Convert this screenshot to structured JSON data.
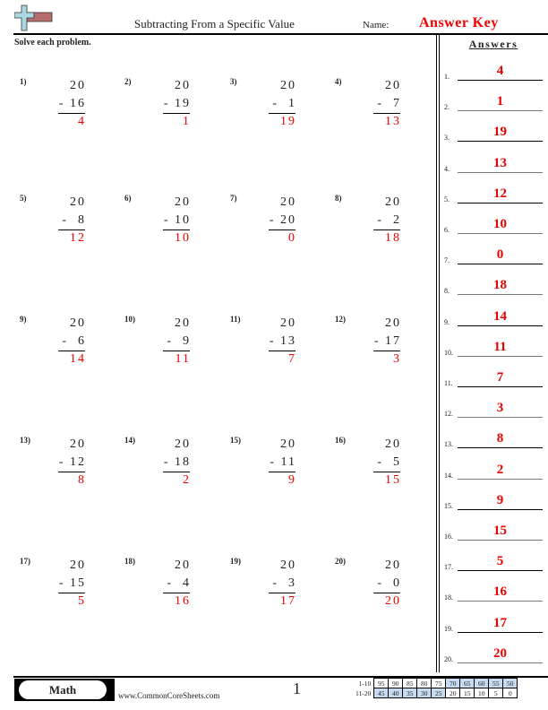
{
  "header": {
    "title": "Subtracting From a Specific Value",
    "name_label": "Name:",
    "answer_key": "Answer Key",
    "instructions": "Solve each problem.",
    "answers_heading": "Answers"
  },
  "problems": [
    {
      "label": "1)",
      "minuend": "20",
      "subtrahend": "- 16",
      "answer": "4"
    },
    {
      "label": "2)",
      "minuend": "20",
      "subtrahend": "- 19",
      "answer": "1"
    },
    {
      "label": "3)",
      "minuend": "20",
      "subtrahend": "-  1",
      "answer": "19"
    },
    {
      "label": "4)",
      "minuend": "20",
      "subtrahend": "-  7",
      "answer": "13"
    },
    {
      "label": "5)",
      "minuend": "20",
      "subtrahend": "-  8",
      "answer": "12"
    },
    {
      "label": "6)",
      "minuend": "20",
      "subtrahend": "- 10",
      "answer": "10"
    },
    {
      "label": "7)",
      "minuend": "20",
      "subtrahend": "- 20",
      "answer": "0"
    },
    {
      "label": "8)",
      "minuend": "20",
      "subtrahend": "-  2",
      "answer": "18"
    },
    {
      "label": "9)",
      "minuend": "20",
      "subtrahend": "-  6",
      "answer": "14"
    },
    {
      "label": "10)",
      "minuend": "20",
      "subtrahend": "-  9",
      "answer": "11"
    },
    {
      "label": "11)",
      "minuend": "20",
      "subtrahend": "- 13",
      "answer": "7"
    },
    {
      "label": "12)",
      "minuend": "20",
      "subtrahend": "- 17",
      "answer": "3"
    },
    {
      "label": "13)",
      "minuend": "20",
      "subtrahend": "- 12",
      "answer": "8"
    },
    {
      "label": "14)",
      "minuend": "20",
      "subtrahend": "- 18",
      "answer": "2"
    },
    {
      "label": "15)",
      "minuend": "20",
      "subtrahend": "- 11",
      "answer": "9"
    },
    {
      "label": "16)",
      "minuend": "20",
      "subtrahend": "-  5",
      "answer": "15"
    },
    {
      "label": "17)",
      "minuend": "20",
      "subtrahend": "- 15",
      "answer": "5"
    },
    {
      "label": "18)",
      "minuend": "20",
      "subtrahend": "-  4",
      "answer": "16"
    },
    {
      "label": "19)",
      "minuend": "20",
      "subtrahend": "-  3",
      "answer": "17"
    },
    {
      "label": "20)",
      "minuend": "20",
      "subtrahend": "-  0",
      "answer": "20"
    }
  ],
  "answer_key": [
    {
      "label": "1.",
      "value": "4"
    },
    {
      "label": "2.",
      "value": "1"
    },
    {
      "label": "3.",
      "value": "19"
    },
    {
      "label": "4.",
      "value": "13"
    },
    {
      "label": "5.",
      "value": "12"
    },
    {
      "label": "6.",
      "value": "10"
    },
    {
      "label": "7.",
      "value": "0"
    },
    {
      "label": "8.",
      "value": "18"
    },
    {
      "label": "9.",
      "value": "14"
    },
    {
      "label": "10.",
      "value": "11"
    },
    {
      "label": "11.",
      "value": "7"
    },
    {
      "label": "12.",
      "value": "3"
    },
    {
      "label": "13.",
      "value": "8"
    },
    {
      "label": "14.",
      "value": "2"
    },
    {
      "label": "15.",
      "value": "9"
    },
    {
      "label": "16.",
      "value": "15"
    },
    {
      "label": "17.",
      "value": "5"
    },
    {
      "label": "18.",
      "value": "16"
    },
    {
      "label": "19.",
      "value": "17"
    },
    {
      "label": "20.",
      "value": "20"
    }
  ],
  "footer": {
    "subject": "Math",
    "website": "www.CommonCoreSheets.com",
    "page_number": "1",
    "score_rows": [
      {
        "range": "1-10",
        "scores": [
          "95",
          "90",
          "85",
          "80",
          "75",
          "70",
          "65",
          "60",
          "55",
          "50"
        ],
        "highlight_from": 5
      },
      {
        "range": "11-20",
        "scores": [
          "45",
          "40",
          "35",
          "30",
          "25",
          "20",
          "15",
          "10",
          "5",
          "0"
        ],
        "highlight_to": 4
      }
    ]
  },
  "colors": {
    "answer_red": "#ee0000",
    "score_highlight": "#c6dbf2"
  }
}
